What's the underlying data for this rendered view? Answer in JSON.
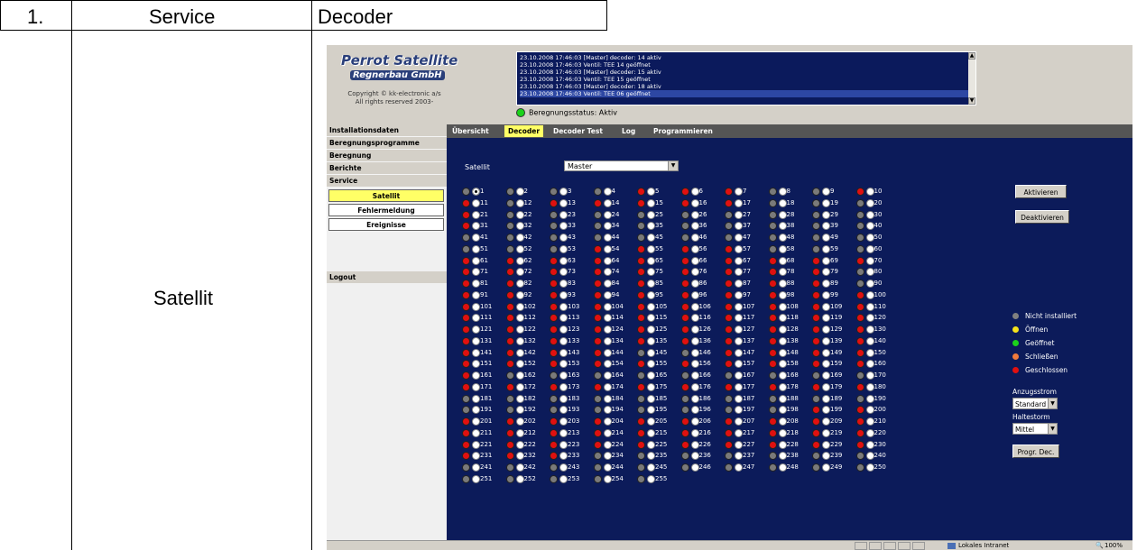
{
  "doc": {
    "num": "1.",
    "col1": "Service",
    "col2": "Decoder",
    "rowlabel": "Satellit"
  },
  "app": {
    "logo_title": "Perrot Satellite",
    "logo_sub": "Regnerbau GmbH",
    "copyright_l1": "Copyright © kk-electronic a/s",
    "copyright_l2": "All rights reserved 2003-",
    "log_lines": [
      "23.10.2008 17:46:03 [Master] decoder: 14 aktiv",
      "23.10.2008 17:46:03 Ventil: TEE 14 geöffnet",
      "23.10.2008 17:46:03 [Master] decoder: 15 aktiv",
      "23.10.2008 17:46:03 Ventil: TEE 15 geöffnet",
      "23.10.2008 17:46:03 [Master] decoder: 18 aktiv",
      "23.10.2008 17:46:03 Ventil: TEE 06 geöffnet"
    ],
    "status_label": "Beregnungsstatus:  Aktiv",
    "nav": [
      "Installationsdaten",
      "Beregnungsprogramme",
      "Beregnung",
      "Berichte",
      "Service"
    ],
    "subnav": [
      "Satellit",
      "Fehlermeldung",
      "Ereignisse"
    ],
    "logout": "Logout",
    "tabs": [
      "Übersicht",
      "Decoder",
      "Decoder Test",
      "Log",
      "Programmieren"
    ],
    "satellit_label": "Satellit",
    "satellit_value": "Master",
    "buttons": {
      "aktivieren": "Aktivieren",
      "deaktivieren": "Deaktivieren",
      "progr": "Progr. Dec."
    },
    "legend": [
      {
        "label": "Nicht installiert",
        "color": "#808080"
      },
      {
        "label": "Öffnen",
        "color": "#f5e21b"
      },
      {
        "label": "Geöffnet",
        "color": "#1bd21b"
      },
      {
        "label": "Schließen",
        "color": "#f07a3c"
      },
      {
        "label": "Geschlossen",
        "color": "#e01010"
      }
    ],
    "anzugsstrom_label": "Anzugsstrom",
    "anzugsstrom_value": "Standard",
    "haltestrom_label": "Haltestorm",
    "haltestrom_value": "Mittel",
    "statusbar_zone": "Lokales Intranet",
    "statusbar_zoom": "100%"
  },
  "decoders": {
    "count": 255,
    "states": [
      "gr",
      "gr",
      "gr",
      "gr",
      "r",
      "r",
      "r",
      "gr",
      "gr",
      "r",
      "r",
      "gr",
      "r",
      "r",
      "r",
      "r",
      "r",
      "gr",
      "gr",
      "gr",
      "r",
      "gr",
      "gr",
      "gr",
      "gr",
      "gr",
      "gr",
      "gr",
      "gr",
      "gr",
      "r",
      "gr",
      "gr",
      "gr",
      "gr",
      "gr",
      "gr",
      "gr",
      "gr",
      "gr",
      "gr",
      "gr",
      "gr",
      "gr",
      "gr",
      "gr",
      "gr",
      "gr",
      "gr",
      "gr",
      "gr",
      "gr",
      "gr",
      "r",
      "r",
      "r",
      "r",
      "gr",
      "gr",
      "gr",
      "r",
      "r",
      "r",
      "r",
      "r",
      "r",
      "r",
      "r",
      "r",
      "r",
      "r",
      "r",
      "r",
      "r",
      "r",
      "r",
      "r",
      "r",
      "r",
      "gr",
      "r",
      "r",
      "r",
      "r",
      "r",
      "r",
      "r",
      "r",
      "r",
      "gr",
      "r",
      "r",
      "r",
      "r",
      "r",
      "r",
      "r",
      "r",
      "r",
      "r",
      "r",
      "r",
      "r",
      "r",
      "r",
      "r",
      "r",
      "r",
      "r",
      "r",
      "r",
      "r",
      "r",
      "r",
      "r",
      "r",
      "r",
      "r",
      "r",
      "r",
      "r",
      "r",
      "r",
      "r",
      "r",
      "r",
      "r",
      "r",
      "r",
      "r",
      "r",
      "r",
      "r",
      "r",
      "r",
      "r",
      "r",
      "r",
      "r",
      "r",
      "r",
      "r",
      "r",
      "r",
      "gr",
      "gr",
      "r",
      "r",
      "r",
      "r",
      "r",
      "r",
      "r",
      "r",
      "r",
      "r",
      "r",
      "r",
      "r",
      "r",
      "r",
      "gr",
      "gr",
      "gr",
      "gr",
      "gr",
      "gr",
      "gr",
      "gr",
      "gr",
      "r",
      "r",
      "r",
      "r",
      "r",
      "r",
      "r",
      "r",
      "r",
      "r",
      "gr",
      "gr",
      "gr",
      "gr",
      "gr",
      "gr",
      "gr",
      "gr",
      "gr",
      "gr",
      "gr",
      "gr",
      "gr",
      "gr",
      "gr",
      "gr",
      "gr",
      "gr",
      "r",
      "r",
      "r",
      "r",
      "r",
      "r",
      "r",
      "r",
      "r",
      "r",
      "r",
      "r",
      "r",
      "r",
      "r",
      "r",
      "r",
      "r",
      "r",
      "r",
      "r",
      "r",
      "r",
      "r",
      "r",
      "r",
      "r",
      "r",
      "r",
      "r",
      "r",
      "r",
      "r",
      "r",
      "r",
      "gr",
      "gr",
      "gr",
      "gr",
      "gr",
      "gr",
      "gr",
      "gr",
      "gr",
      "gr",
      "gr",
      "gr",
      "gr",
      "gr",
      "gr",
      "gr",
      "gr",
      "gr",
      "gr",
      "gr",
      "gr",
      "gr"
    ]
  }
}
